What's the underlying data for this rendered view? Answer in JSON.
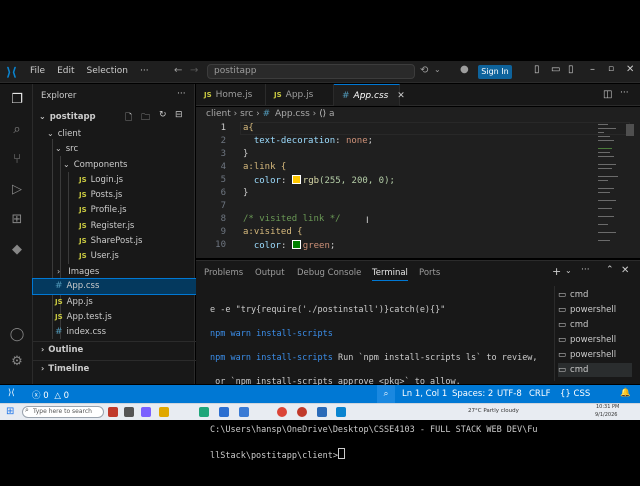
{
  "titlebar": {
    "menu": [
      "File",
      "Edit",
      "Selection",
      "···"
    ],
    "search": "postitapp",
    "signin": "Sign In"
  },
  "explorer": {
    "header": "Explorer",
    "project": "postitapp",
    "items": [
      {
        "label": "client",
        "kind": "folder"
      },
      {
        "label": "src",
        "kind": "folder"
      },
      {
        "label": "Components",
        "kind": "folder"
      },
      {
        "label": "Login.js",
        "kind": "js"
      },
      {
        "label": "Posts.js",
        "kind": "js"
      },
      {
        "label": "Profile.js",
        "kind": "js"
      },
      {
        "label": "Register.js",
        "kind": "js"
      },
      {
        "label": "SharePost.js",
        "kind": "js"
      },
      {
        "label": "User.js",
        "kind": "js"
      },
      {
        "label": "Images",
        "kind": "folder"
      },
      {
        "label": "App.css",
        "kind": "css"
      },
      {
        "label": "App.js",
        "kind": "js"
      },
      {
        "label": "App.test.js",
        "kind": "js"
      },
      {
        "label": "index.css",
        "kind": "css"
      }
    ],
    "outline": "Outline",
    "timeline": "Timeline"
  },
  "tabs": [
    "Home.js",
    "App.js",
    "App.css"
  ],
  "breadcrumb": [
    "client",
    "src",
    "App.css",
    "a"
  ],
  "editor": {
    "line_numbers": [
      "1",
      "2",
      "3",
      "4",
      "5",
      "6",
      "7",
      "8",
      "9",
      "10"
    ],
    "l1": "a{",
    "l2_prop": "text-decoration",
    "l2_val": "none",
    "l3": "}",
    "l4": "a:link {",
    "l5_prop": "color",
    "l5_fn": "rgb",
    "l5_args": "(255, 200, 0);",
    "l6": "}",
    "l8": "/* visited link */",
    "l9": "a:visited {",
    "l10_prop": "color",
    "l10_val": "green",
    "swatch_yellow": "#ffc800",
    "swatch_green": "#008000"
  },
  "panel": {
    "tabs": [
      "Problems",
      "Output",
      "Debug Console",
      "Terminal",
      "Ports"
    ],
    "terminal_lines": [
      "e -e \"try{require('./postinstall')}catch(e){}\"",
      "npm warn install-scripts",
      "npm warn install-scripts Run `npm install-scripts ls` to review,",
      " or `npm install-scripts approve <pkg>` to allow.",
      "",
      "C:\\Users\\hansp\\OneDrive\\Desktop\\CSSE4103 - FULL STACK WEB DEV\\Fu",
      "llStack\\postitapp\\client>"
    ],
    "terminals": [
      "cmd",
      "powershell",
      "cmd",
      "powershell",
      "powershell",
      "cmd"
    ]
  },
  "status": {
    "errors": "0",
    "warnings": "0",
    "position": "Ln 1, Col 1",
    "spaces": "Spaces: 2",
    "encoding": "UTF-8",
    "eol": "CRLF",
    "language": "CSS"
  },
  "taskbar": {
    "search": "Type here to search",
    "weather": "27°C  Partly cloudy",
    "time": "10:31 PM",
    "date": "9/1/2026"
  }
}
